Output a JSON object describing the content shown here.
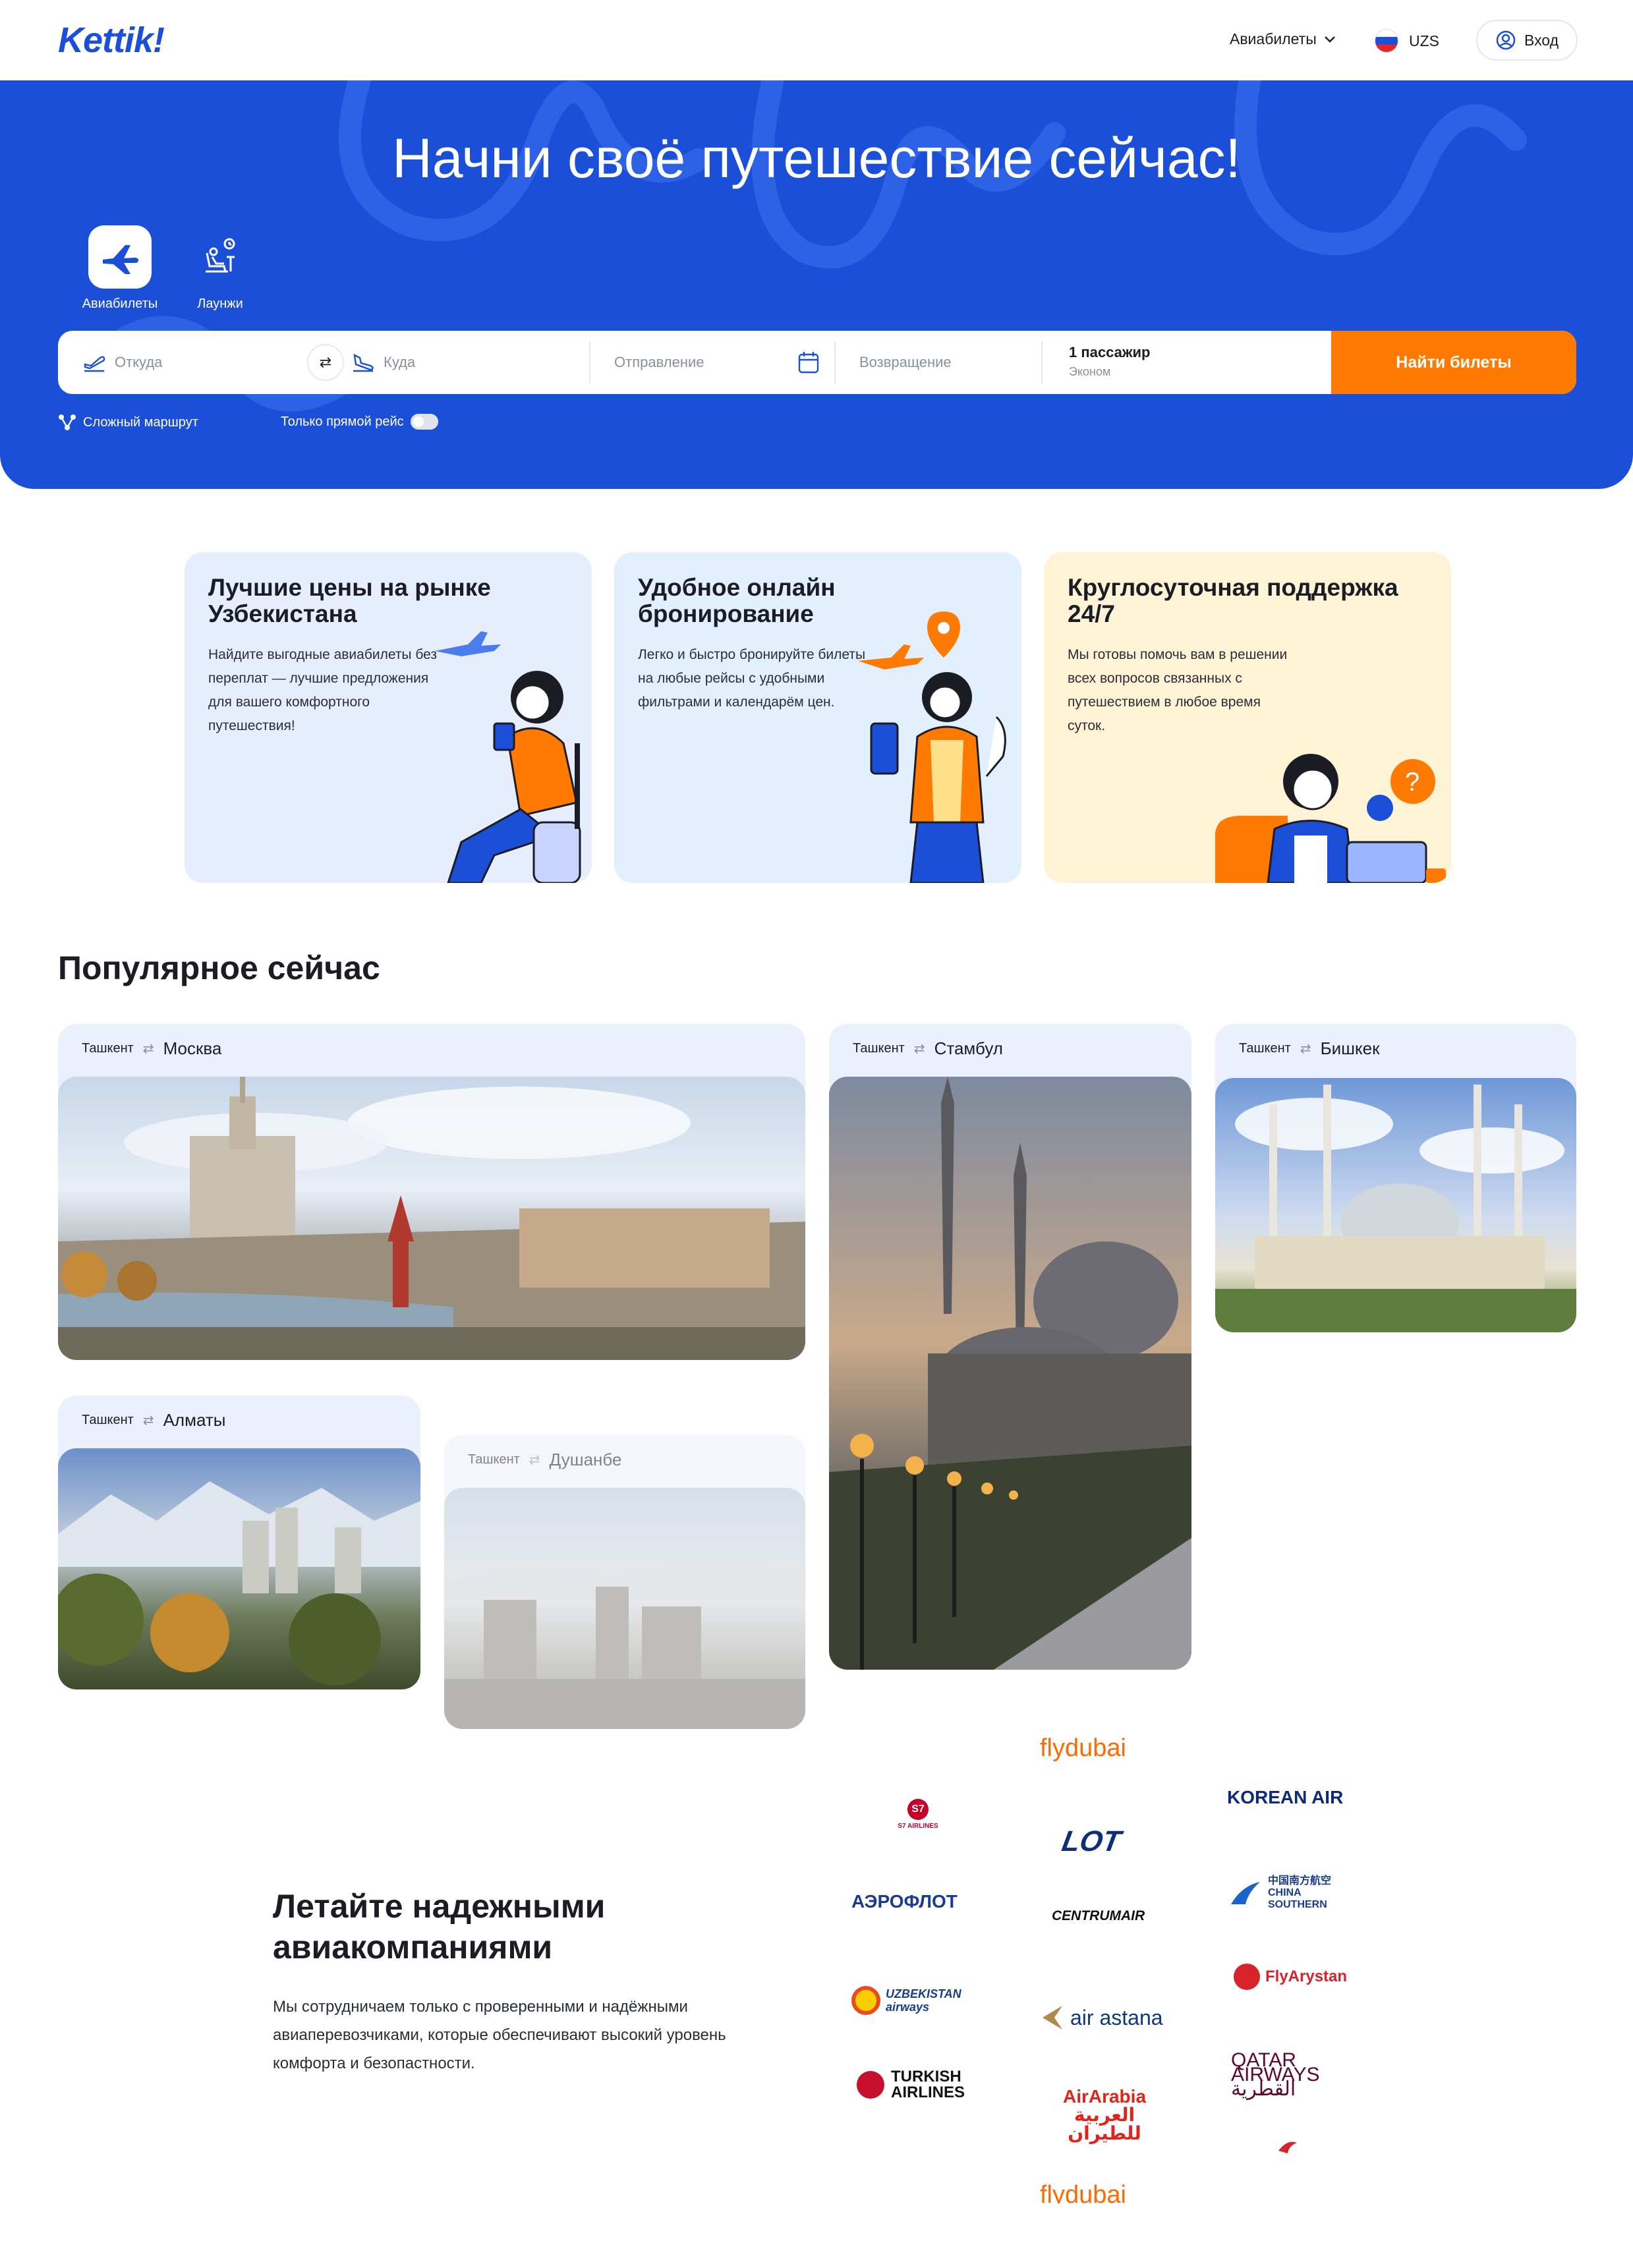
{
  "header": {
    "logo": "Kettik!",
    "nav_tickets": "Авиабилеты",
    "currency": "UZS",
    "login": "Вход"
  },
  "hero": {
    "title": "Начни своё путешествие сейчас!",
    "modes": [
      {
        "label": "Авиабилеты",
        "icon": "airplane-icon",
        "active": true
      },
      {
        "label": "Лаунжи",
        "icon": "lounge-icon",
        "active": false
      }
    ],
    "search": {
      "from_placeholder": "Откуда",
      "to_placeholder": "Куда",
      "depart_placeholder": "Отправление",
      "return_placeholder": "Возвращение",
      "passengers": "1 пассажир",
      "cabin_class": "Эконом",
      "find_button": "Найти билеты"
    },
    "options": {
      "complex_route": "Сложный маршрут",
      "direct_only": "Только прямой рейс",
      "direct_only_on": false
    }
  },
  "features": [
    {
      "title": "Лучшие цены на рынке Узбекистана",
      "text": "Найдите выгодные авиабилеты без переплат — лучшие предложения для вашего комфортного путешествия!",
      "bg": "#e6eefe"
    },
    {
      "title": "Удобное онлайн бронирование",
      "text": "Легко и быстро бронируйте билеты на любые рейсы с удобными фильтрами и календарём цен.",
      "bg": "#e1efff"
    },
    {
      "title": "Круглосуточная поддержка 24/7",
      "text": "Мы готовы помочь вам в решении всех вопросов связанных с путешествием в любое время суток.",
      "bg": "#fff3d6"
    }
  ],
  "popular": {
    "title": "Популярное сейчас",
    "origin": "Ташкент",
    "destinations": [
      "Москва",
      "Стамбул",
      "Бишкек",
      "Алматы",
      "Душанбе"
    ]
  },
  "airlines": {
    "title": "Летайте надежными авиакомпаниями",
    "text": "Мы сотрудничаем только с проверенными и надёжными авиаперевозчиками, которые обеспечивают высокий уровень комфорта и безопастности.",
    "logos": [
      "flydubai",
      "S7 AIRLINES",
      "LOT",
      "KOREAN AIR",
      "АЭРОФЛОТ",
      "CENTRUMAIR",
      "中国南方航空 CHINA SOUTHERN",
      "UZBEKISTAN airways",
      "air astana",
      "FlyArystan",
      "TURKISH AIRLINES",
      "AirArabia العربية للطيران",
      "QATAR AIRWAYS القطرية",
      "flydubai"
    ]
  },
  "colors": {
    "brand": "#1b4fd8",
    "accent": "#ff7a00"
  }
}
